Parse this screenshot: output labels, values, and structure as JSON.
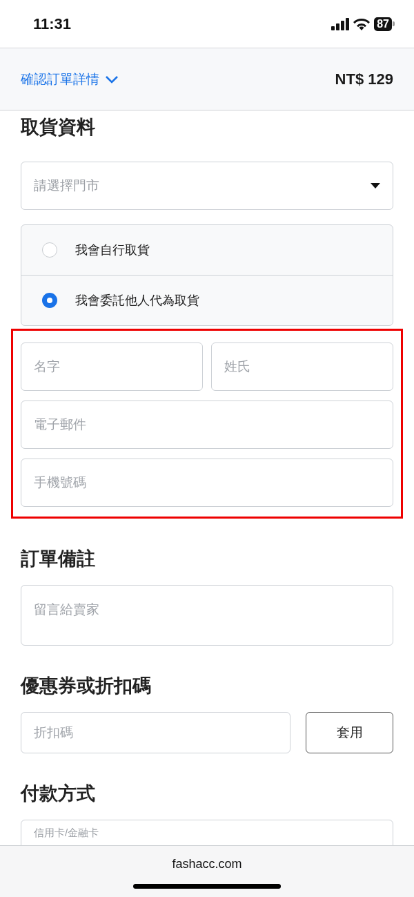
{
  "status_bar": {
    "time": "11:31",
    "battery": "87"
  },
  "header": {
    "title": "確認訂單詳情",
    "total": "NT$ 129"
  },
  "pickup": {
    "heading": "取貨資料",
    "store_select": {
      "placeholder": "請選擇門市"
    },
    "options": [
      {
        "label": "我會自行取貨",
        "selected": false
      },
      {
        "label": "我會委託他人代為取貨",
        "selected": true
      }
    ],
    "contact": {
      "highlighted": true,
      "first_name": {
        "placeholder": "名字"
      },
      "last_name": {
        "placeholder": "姓氏"
      },
      "email": {
        "placeholder": "電子郵件"
      },
      "phone": {
        "placeholder": "手機號碼"
      }
    }
  },
  "note": {
    "heading": "訂單備註",
    "field": {
      "placeholder": "留言給賣家"
    }
  },
  "coupon": {
    "heading": "優惠券或折扣碼",
    "field": {
      "placeholder": "折扣碼"
    },
    "button": "套用"
  },
  "payment": {
    "heading": "付款方式",
    "field": {
      "placeholder": "信用卡/金融卡"
    }
  },
  "bottom_bar": {
    "url": "fashacc.com"
  }
}
